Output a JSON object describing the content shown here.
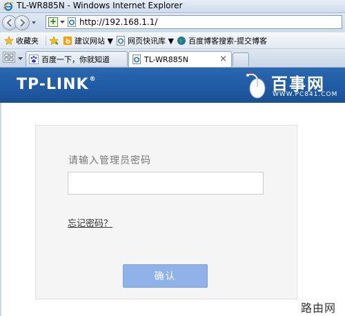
{
  "window": {
    "title": "TL-WR885N - Windows Internet Explorer"
  },
  "address_bar": {
    "url": "http://192.168.1.1/"
  },
  "favorites_bar": {
    "favorites_label": "收藏夹",
    "items": [
      {
        "label": "建议网站 ▼",
        "icon": "suggested-sites-icon"
      },
      {
        "label": "网页快讯库 ▼",
        "icon": "web-slice-icon"
      },
      {
        "label": "百度博客搜索-提交博客",
        "icon": "globe-icon"
      }
    ]
  },
  "tabs": [
    {
      "label": "百度一下，你就知道",
      "active": false
    },
    {
      "label": "TL-WR885N",
      "active": true,
      "close": "×"
    }
  ],
  "header": {
    "logo": "TP-LINK",
    "logo_mark": "®",
    "watermark_brand": "百事网",
    "watermark_url": "WWW.PC841.COM"
  },
  "login": {
    "prompt": "请输入管理员密码",
    "password_value": "",
    "forgot_link": "忘记密码？",
    "confirm_button": "确认"
  },
  "corner_watermark": "路由网",
  "colors": {
    "header_blue": "#1f5aa3",
    "button_blue": "#8fb3e9",
    "panel_bg": "#f5f5f5"
  }
}
